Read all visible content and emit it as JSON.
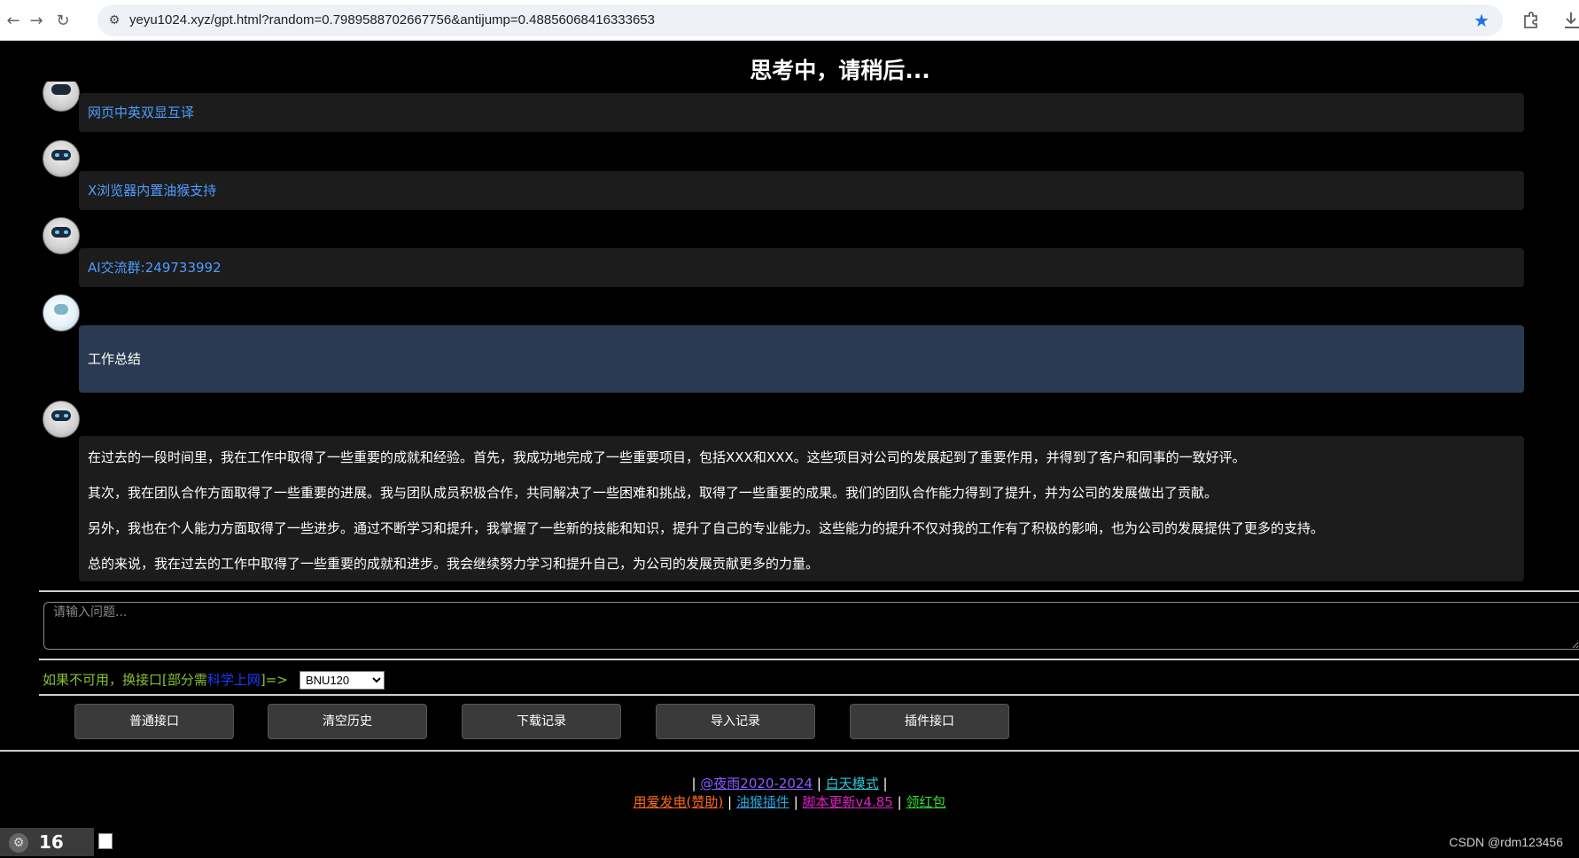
{
  "browser": {
    "url": "yeyu1024.xyz/gpt.html?random=0.7989588702667756&antijump=0.48856068416333653"
  },
  "page": {
    "title": "思考中，请稍后..."
  },
  "messages": {
    "link1": "网页中英双显互译",
    "link2": "X浏览器内置油猴支持",
    "link3": "AI交流群:249733992",
    "user_question": "工作总结",
    "answer": [
      "在过去的一段时间里，我在工作中取得了一些重要的成就和经验。首先，我成功地完成了一些重要项目，包括XXX和XXX。这些项目对公司的发展起到了重要作用，并得到了客户和同事的一致好评。",
      "其次，我在团队合作方面取得了一些重要的进展。我与团队成员积极合作，共同解决了一些困难和挑战，取得了一些重要的成果。我们的团队合作能力得到了提升，并为公司的发展做出了贡献。",
      "另外，我也在个人能力方面取得了一些进步。通过不断学习和提升，我掌握了一些新的技能和知识，提升了自己的专业能力。这些能力的提升不仅对我的工作有了积极的影响，也为公司的发展提供了更多的支持。",
      "总的来说，我在过去的工作中取得了一些重要的成就和进步。我会继续努力学习和提升自己，为公司的发展贡献更多的力量。"
    ]
  },
  "input": {
    "placeholder": "请输入问题..."
  },
  "api": {
    "prefix": "如果不可用，换接口[部分需",
    "link": "科学上网",
    "suffix": "]=>",
    "selected": "BNU120"
  },
  "buttons": {
    "normal": "普通接口",
    "clear": "清空历史",
    "download": "下载记录",
    "import": "导入记录",
    "plugin": "插件接口"
  },
  "footer": {
    "line1_pipe_start": "|",
    "copyright": "@夜雨2020-2024",
    "pipe1": "|",
    "day_mode": "白天模式",
    "pipe2": "|",
    "donate": "用爱发电(赞助)",
    "pipe3": "|",
    "tampermonkey": "油猴插件",
    "pipe4": "|",
    "script_update": "脚本更新v4.85",
    "pipe5": "|",
    "red_packet": "领红包"
  },
  "bottom": {
    "count": "16",
    "watermark": "CSDN @rdm123456"
  },
  "colors": {
    "link": "#4f9cff",
    "user_bubble": "#2a3a52",
    "api_text": "#86c232",
    "copyright": "#8a5cff",
    "day_mode": "#29c7d6",
    "donate": "#ff6a1a",
    "tampermonkey": "#29a8e0",
    "script_update": "#e020c8",
    "red_packet": "#2ee030"
  }
}
